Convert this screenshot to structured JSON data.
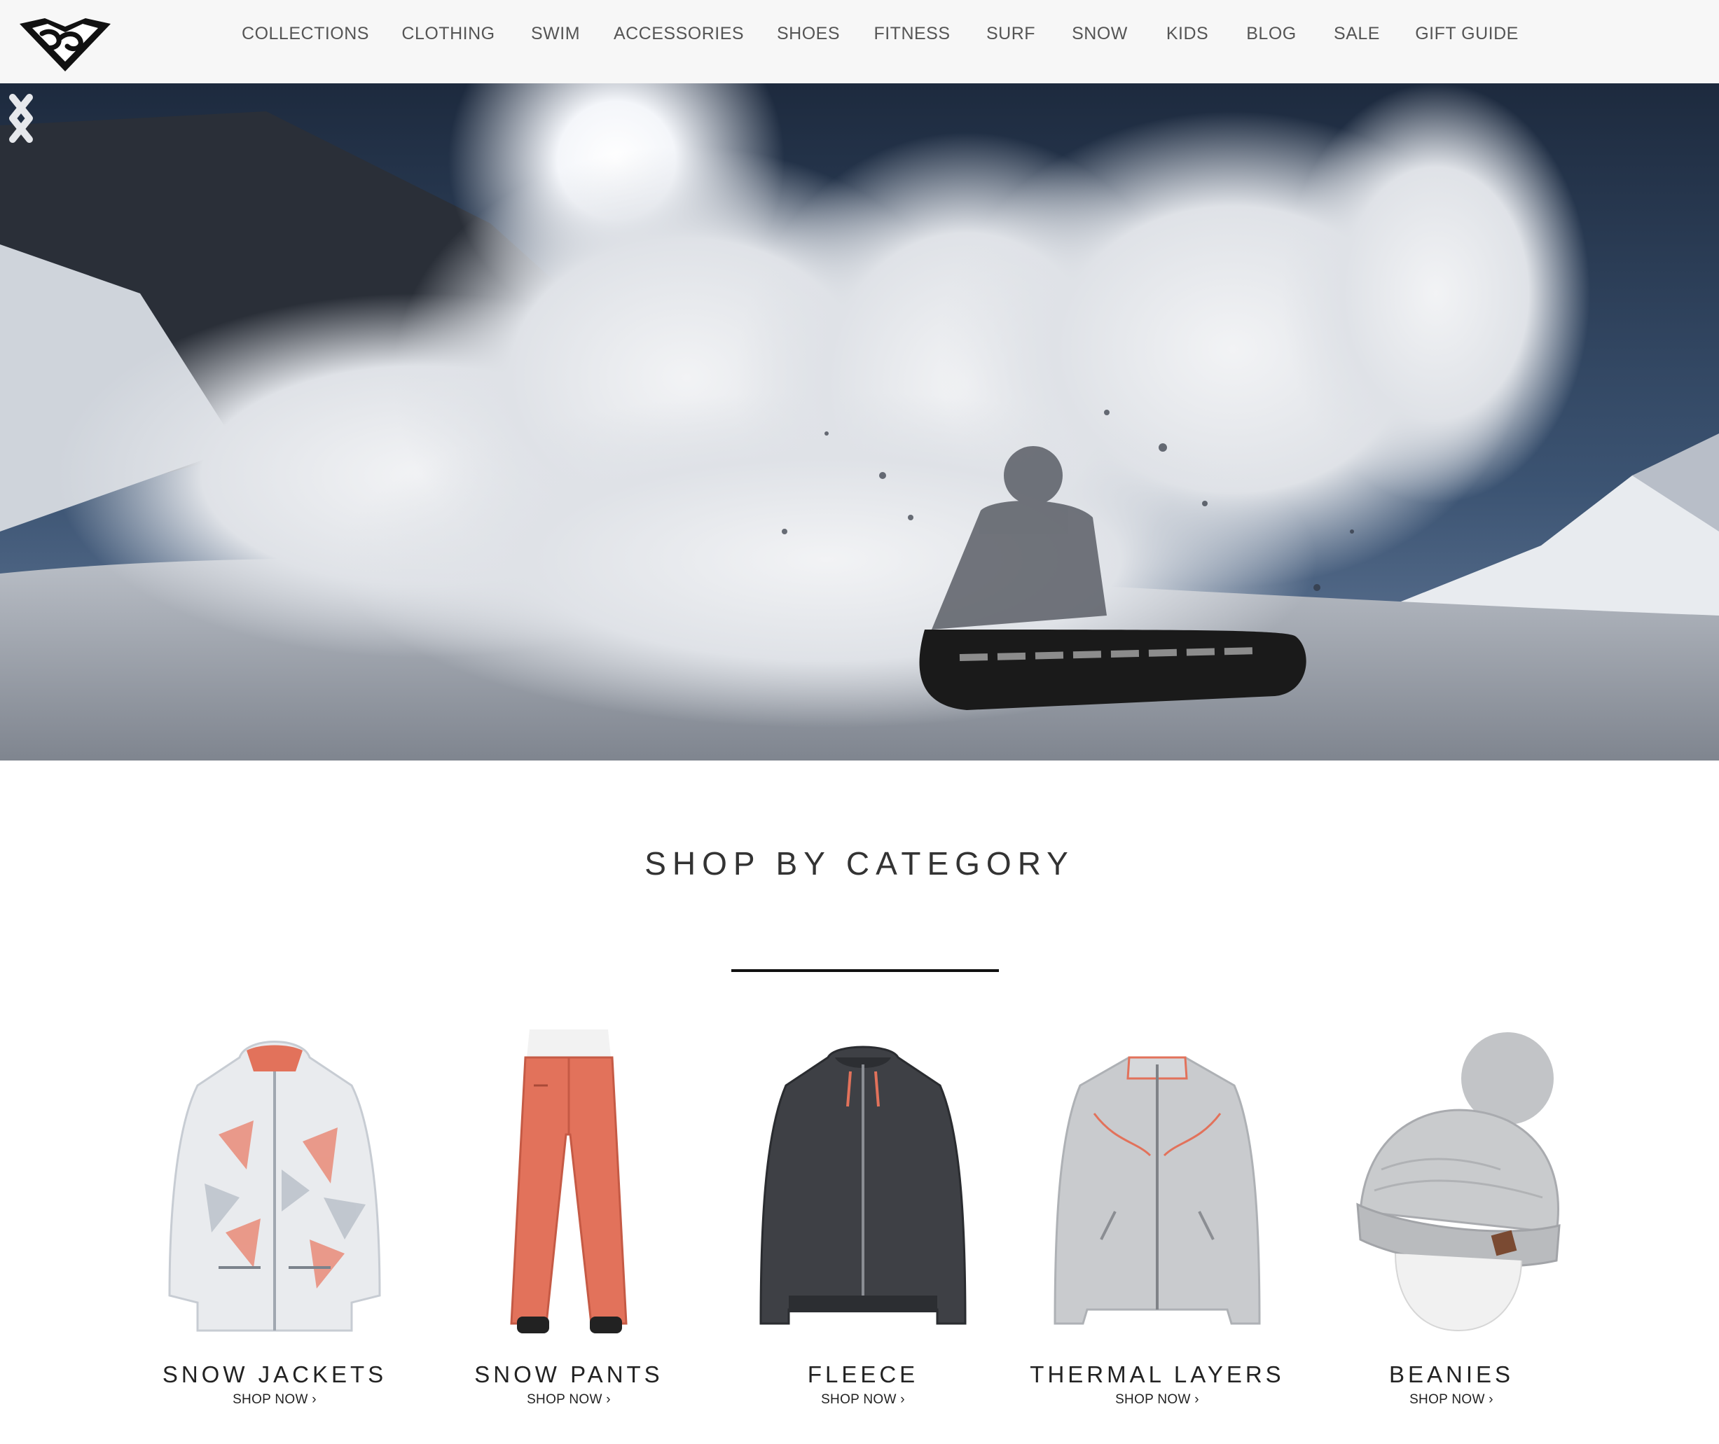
{
  "brand": {
    "name": "Roxy",
    "logo_icon": "roxy-heart-logo-icon"
  },
  "nav": {
    "items": [
      "COLLECTIONS",
      "CLOTHING",
      "SWIM",
      "ACCESSORIES",
      "SHOES",
      "FITNESS",
      "SURF",
      "SNOW",
      "KIDS",
      "BLOG",
      "SALE",
      "GIFT GUIDE"
    ]
  },
  "hero": {
    "scene": "snowboarder in snow spray",
    "prev_icon": "chevron-left-icon",
    "next_icon": "chevron-right-icon",
    "slides_count": 4,
    "active_slide": 3
  },
  "category_section": {
    "title": "SHOP BY CATEGORY",
    "items": [
      {
        "title": "SNOW JACKETS",
        "cta": "SHOP NOW ›",
        "image": "snow-jacket-image"
      },
      {
        "title": "SNOW PANTS",
        "cta": "SHOP NOW ›",
        "image": "snow-pants-image"
      },
      {
        "title": "FLEECE",
        "cta": "SHOP NOW ›",
        "image": "fleece-image"
      },
      {
        "title": "THERMAL LAYERS",
        "cta": "SHOP NOW ›",
        "image": "thermal-layer-image"
      },
      {
        "title": "BEANIES",
        "cta": "SHOP NOW ›",
        "image": "beanie-image"
      }
    ]
  },
  "colors": {
    "header_bg": "#f7f7f7",
    "nav_text": "#555555",
    "heading_text": "#333333",
    "divider": "#111111",
    "accent_coral": "#e2725b"
  }
}
